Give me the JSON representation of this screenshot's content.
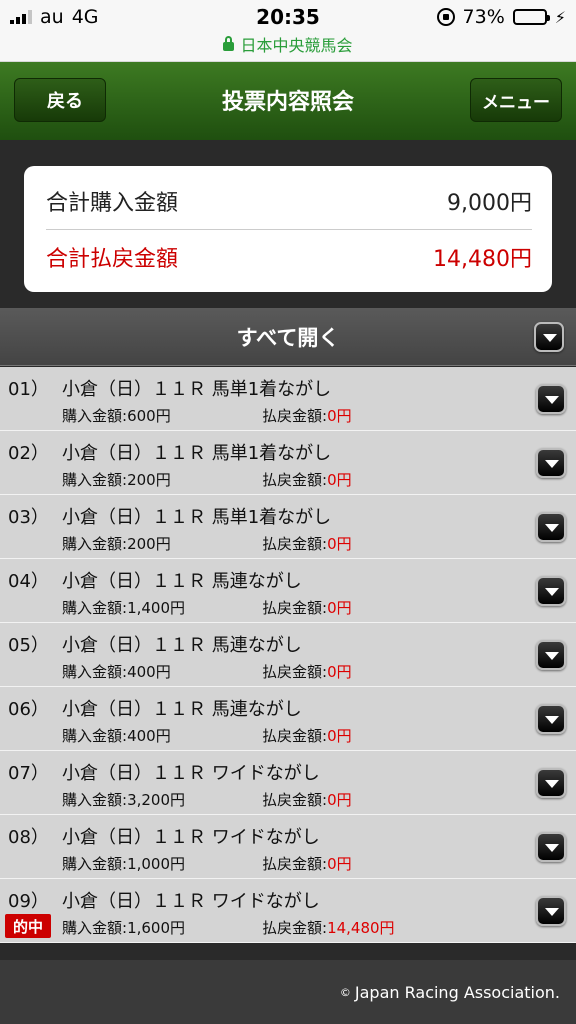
{
  "status_bar": {
    "carrier": "au",
    "network": "4G",
    "time": "20:35",
    "battery": "73%",
    "battery_level": 0.73,
    "url": "日本中央競馬会"
  },
  "header": {
    "back_label": "戻る",
    "title": "投票内容照会",
    "menu_label": "メニュー"
  },
  "summary": {
    "purchase_label": "合計購入金額",
    "purchase_value": "9,000円",
    "payout_label": "合計払戻金額",
    "payout_value": "14,480円"
  },
  "expand_all_label": "すべて開く",
  "bets": [
    {
      "no": "01）",
      "title": "小倉（日）１１Ｒ 馬単1着ながし",
      "buy_label": "購入金額:",
      "buy": "600円",
      "pay_label": "払戻金額:",
      "pay": "0円",
      "hit": ""
    },
    {
      "no": "02）",
      "title": "小倉（日）１１Ｒ 馬単1着ながし",
      "buy_label": "購入金額:",
      "buy": "200円",
      "pay_label": "払戻金額:",
      "pay": "0円",
      "hit": ""
    },
    {
      "no": "03）",
      "title": "小倉（日）１１Ｒ 馬単1着ながし",
      "buy_label": "購入金額:",
      "buy": "200円",
      "pay_label": "払戻金額:",
      "pay": "0円",
      "hit": ""
    },
    {
      "no": "04）",
      "title": "小倉（日）１１Ｒ 馬連ながし",
      "buy_label": "購入金額:",
      "buy": "1,400円",
      "pay_label": "払戻金額:",
      "pay": "0円",
      "hit": ""
    },
    {
      "no": "05）",
      "title": "小倉（日）１１Ｒ 馬連ながし",
      "buy_label": "購入金額:",
      "buy": "400円",
      "pay_label": "払戻金額:",
      "pay": "0円",
      "hit": ""
    },
    {
      "no": "06）",
      "title": "小倉（日）１１Ｒ 馬連ながし",
      "buy_label": "購入金額:",
      "buy": "400円",
      "pay_label": "払戻金額:",
      "pay": "0円",
      "hit": ""
    },
    {
      "no": "07）",
      "title": "小倉（日）１１Ｒ ワイドながし",
      "buy_label": "購入金額:",
      "buy": "3,200円",
      "pay_label": "払戻金額:",
      "pay": "0円",
      "hit": ""
    },
    {
      "no": "08）",
      "title": "小倉（日）１１Ｒ ワイドながし",
      "buy_label": "購入金額:",
      "buy": "1,000円",
      "pay_label": "払戻金額:",
      "pay": "0円",
      "hit": ""
    },
    {
      "no": "09）",
      "title": "小倉（日）１１Ｒ ワイドながし",
      "buy_label": "購入金額:",
      "buy": "1,600円",
      "pay_label": "払戻金額:",
      "pay": "14,480円",
      "hit": "的中"
    }
  ],
  "footer": {
    "copyright_symbol": "©",
    "text": "Japan Racing Association."
  },
  "colors": {
    "header_green": "#2e6418",
    "payout_red": "#cc0000",
    "url_green": "#2a9d3a"
  }
}
